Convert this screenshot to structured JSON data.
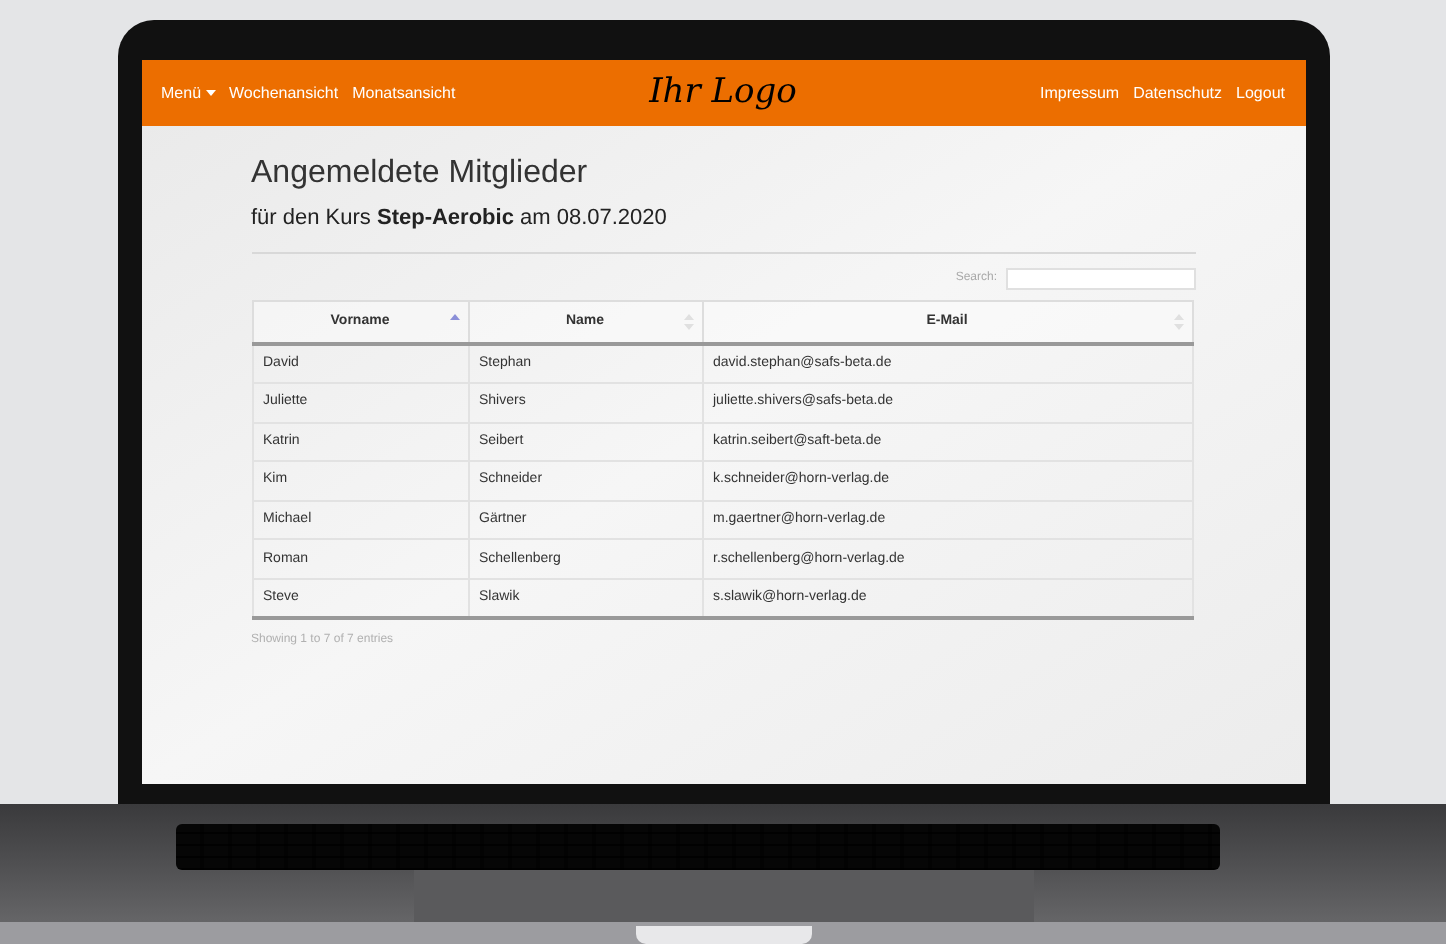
{
  "navbar": {
    "left_items": [
      {
        "label": "Menü",
        "kind": "dropdown"
      },
      {
        "label": "Wochenansicht",
        "kind": "link"
      },
      {
        "label": "Monatsansicht",
        "kind": "link"
      }
    ],
    "logo": "Ihr Logo",
    "right_items": [
      {
        "label": "Impressum"
      },
      {
        "label": "Datenschutz"
      },
      {
        "label": "Logout"
      }
    ]
  },
  "heading": "Angemeldete Mitglieder",
  "subtitle": "für den Kurs **Step-Aerobic** am 08.07.2020",
  "search": {
    "label": "Search:"
  },
  "table": {
    "columns": [
      {
        "label": "Vorname",
        "sorted": true
      },
      {
        "label": "Name",
        "sorted": false
      },
      {
        "label": "E-Mail",
        "sorted": false
      }
    ],
    "rows": [
      [
        "David",
        "Stephan",
        "david.stephan@safs-beta.de"
      ],
      [
        "Juliette",
        "Shivers",
        "juliette.shivers@safs-beta.de"
      ],
      [
        "Katrin",
        "Seibert",
        "katrin.seibert@saft-beta.de"
      ],
      [
        "Kim",
        "Schneider",
        "k.schneider@horn-verlag.de"
      ],
      [
        "Michael",
        "Gärtner",
        "m.gaertner@horn-verlag.de"
      ],
      [
        "Roman",
        "Schellenberg",
        "r.schellenberg@horn-verlag.de"
      ],
      [
        "Steve",
        "Slawik",
        "s.slawik@horn-verlag.de"
      ]
    ]
  },
  "table_info": "Showing 1 to 7 of 7 entries"
}
